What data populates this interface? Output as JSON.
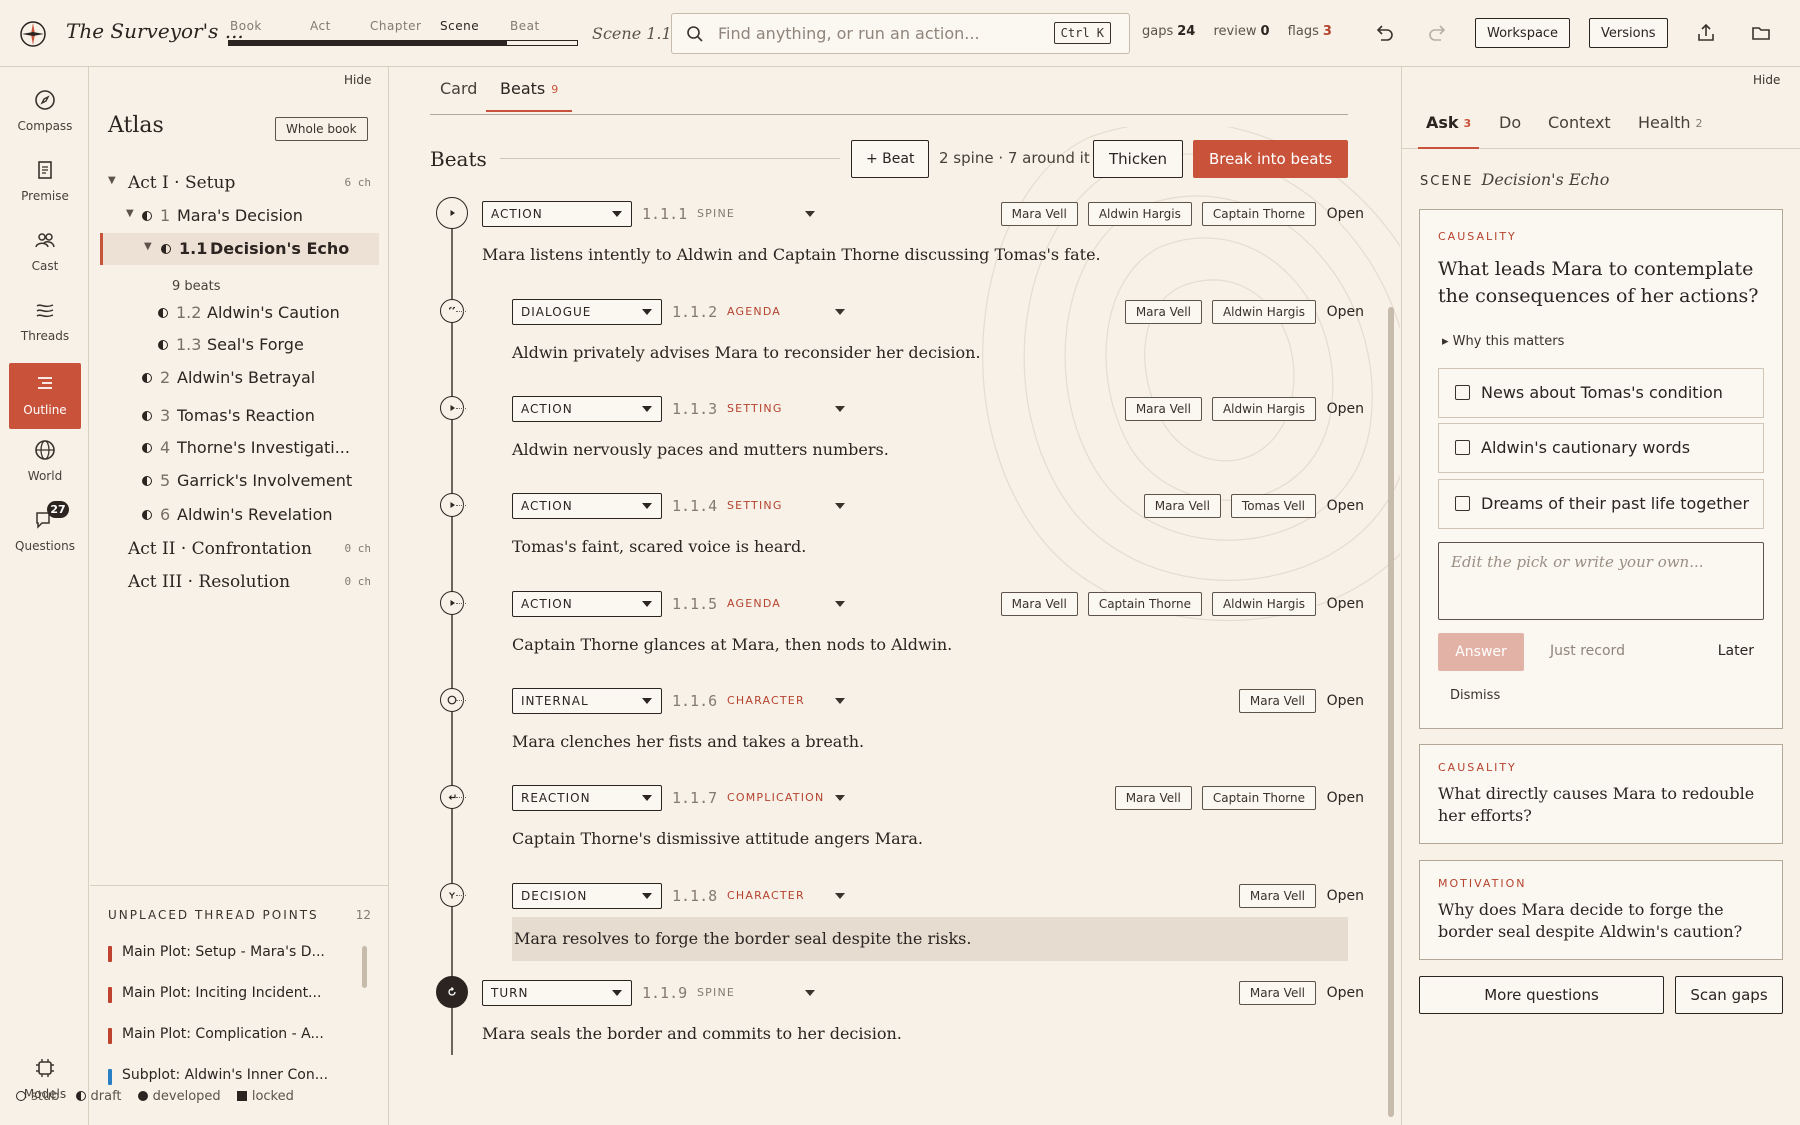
{
  "app": {
    "title": "The Surveyor's ..."
  },
  "levels": [
    {
      "label": "Book",
      "active": false
    },
    {
      "label": "Act",
      "active": false
    },
    {
      "label": "Chapter",
      "active": false
    },
    {
      "label": "Scene",
      "active": true
    },
    {
      "label": "Beat",
      "active": false
    }
  ],
  "level_progress": 0.8,
  "scene_crumb": "Scene 1.1",
  "search": {
    "placeholder": "Find anything, or run an action...",
    "shortcut": "Ctrl K"
  },
  "stats": {
    "gaps_label": "gaps",
    "gaps": "24",
    "review_label": "review",
    "review": "0",
    "flags_label": "flags",
    "flags": "3"
  },
  "top_buttons": {
    "workspace": "Workspace",
    "versions": "Versions"
  },
  "nav": [
    {
      "label": "Compass",
      "icon": "compass-icon"
    },
    {
      "label": "Premise",
      "icon": "document-icon"
    },
    {
      "label": "Cast",
      "icon": "people-icon"
    },
    {
      "label": "Threads",
      "icon": "threads-icon"
    },
    {
      "label": "Outline",
      "icon": "outline-icon",
      "active": true
    },
    {
      "label": "World",
      "icon": "globe-icon"
    },
    {
      "label": "Questions",
      "icon": "chat-icon",
      "badge": "27"
    }
  ],
  "nav_bottom": {
    "label": "Models",
    "icon": "chip-icon"
  },
  "atlas": {
    "hide": "Hide",
    "title": "Atlas",
    "whole_book": "Whole book",
    "tree": [
      {
        "kind": "act",
        "label": "Act I · Setup",
        "count": "6 ch",
        "expanded": true
      },
      {
        "kind": "chapter",
        "num": "1",
        "label": "Mara's Decision",
        "expanded": true
      },
      {
        "kind": "scene",
        "num": "1.1",
        "label": "Decision's Echo",
        "selected": true,
        "expanded": true
      },
      {
        "kind": "scene",
        "num": "1.2",
        "label": "Aldwin's Caution"
      },
      {
        "kind": "scene",
        "num": "1.3",
        "label": "Seal's Forge"
      },
      {
        "kind": "chapter",
        "num": "2",
        "label": "Aldwin's Betrayal"
      },
      {
        "kind": "chapter",
        "num": "3",
        "label": "Tomas's Reaction"
      },
      {
        "kind": "chapter",
        "num": "4",
        "label": "Thorne's Investigati..."
      },
      {
        "kind": "chapter",
        "num": "5",
        "label": "Garrick's Involvement"
      },
      {
        "kind": "chapter",
        "num": "6",
        "label": "Aldwin's Revelation"
      },
      {
        "kind": "act",
        "label": "Act II · Confrontation",
        "count": "0 ch"
      },
      {
        "kind": "act",
        "label": "Act III · Resolution",
        "count": "0 ch"
      }
    ],
    "beats_count": "9 beats",
    "unplaced_title": "UNPLACED THREAD POINTS",
    "unplaced_count": "12",
    "thread_points": [
      {
        "label": "Main Plot: Setup - Mara's D...",
        "color": "#c0432f"
      },
      {
        "label": "Main Plot: Inciting Incident...",
        "color": "#c0432f"
      },
      {
        "label": "Main Plot: Complication - A...",
        "color": "#c0432f"
      },
      {
        "label": "Subplot: Aldwin's Inner Con...",
        "color": "#2a7fc4"
      }
    ],
    "legend": [
      "stub",
      "draft",
      "developed",
      "locked"
    ]
  },
  "main": {
    "tabs": [
      {
        "label": "Card"
      },
      {
        "label": "Beats",
        "count": "9",
        "active": true
      }
    ],
    "heading": "Beats",
    "add_beat": "+ Beat",
    "meta": "2 spine · 7 around it",
    "thicken": "Thicken",
    "break": "Break into beats",
    "open_label": "Open",
    "beats": [
      {
        "type": "ACTION",
        "num": "1.1.1",
        "func": "SPINE",
        "func_red": false,
        "spine": true,
        "icon": "play",
        "chars": [
          "Mara Vell",
          "Aldwin Hargis",
          "Captain Thorne"
        ],
        "text": "Mara listens intently to Aldwin and Captain Thorne discussing Tomas's fate."
      },
      {
        "type": "DIALOGUE",
        "num": "1.1.2",
        "func": "AGENDA",
        "func_red": true,
        "icon": "quote",
        "chars": [
          "Mara Vell",
          "Aldwin Hargis"
        ],
        "text": "Aldwin privately advises Mara to reconsider her decision."
      },
      {
        "type": "ACTION",
        "num": "1.1.3",
        "func": "SETTING",
        "func_red": true,
        "icon": "play",
        "chars": [
          "Mara Vell",
          "Aldwin Hargis"
        ],
        "text": "Aldwin nervously paces and mutters numbers."
      },
      {
        "type": "ACTION",
        "num": "1.1.4",
        "func": "SETTING",
        "func_red": true,
        "icon": "play",
        "chars": [
          "Mara Vell",
          "Tomas Vell"
        ],
        "text": "Tomas's faint, scared voice is heard."
      },
      {
        "type": "ACTION",
        "num": "1.1.5",
        "func": "AGENDA",
        "func_red": true,
        "icon": "play",
        "chars": [
          "Mara Vell",
          "Captain Thorne",
          "Aldwin Hargis"
        ],
        "text": "Captain Thorne glances at Mara, then nods to Aldwin."
      },
      {
        "type": "INTERNAL",
        "num": "1.1.6",
        "func": "CHARACTER",
        "func_red": true,
        "icon": "circle",
        "chars": [
          "Mara Vell"
        ],
        "text": "Mara clenches her fists and takes a breath."
      },
      {
        "type": "REACTION",
        "num": "1.1.7",
        "func": "COMPLICATION",
        "func_red": true,
        "icon": "return",
        "chars": [
          "Mara Vell",
          "Captain Thorne"
        ],
        "text": "Captain Thorne's dismissive attitude angers Mara."
      },
      {
        "type": "DECISION",
        "num": "1.1.8",
        "func": "CHARACTER",
        "func_red": true,
        "icon": "fork",
        "chars": [
          "Mara Vell"
        ],
        "text": "Mara resolves to forge the border seal despite the risks.",
        "highlight": true
      },
      {
        "type": "TURN",
        "num": "1.1.9",
        "func": "SPINE",
        "func_red": false,
        "spine": true,
        "turn": true,
        "icon": "rotate",
        "chars": [
          "Mara Vell"
        ],
        "text": "Mara seals the border and commits to her decision."
      }
    ]
  },
  "right": {
    "hide": "Hide",
    "tabs": [
      {
        "label": "Ask",
        "count": "3",
        "active": true
      },
      {
        "label": "Do"
      },
      {
        "label": "Context"
      },
      {
        "label": "Health",
        "count": "2"
      }
    ],
    "scene_label": "SCENE",
    "scene_name": "Decision's Echo",
    "active_q": {
      "tag": "CAUSALITY",
      "question": "What leads Mara to contemplate the consequences of her actions?",
      "why": "▸ Why this matters",
      "options": [
        "News about Tomas's condition",
        "Aldwin's cautionary words",
        "Dreams of their past life together"
      ],
      "own_placeholder": "Edit the pick or write your own...",
      "answer": "Answer",
      "just_record": "Just record",
      "later": "Later",
      "dismiss": "Dismiss"
    },
    "questions": [
      {
        "tag": "CAUSALITY",
        "question": "What directly causes Mara to redouble her efforts?"
      },
      {
        "tag": "MOTIVATION",
        "question": "Why does Mara decide to forge the border seal despite Aldwin's caution?"
      }
    ],
    "more": "More questions",
    "scan": "Scan gaps"
  }
}
